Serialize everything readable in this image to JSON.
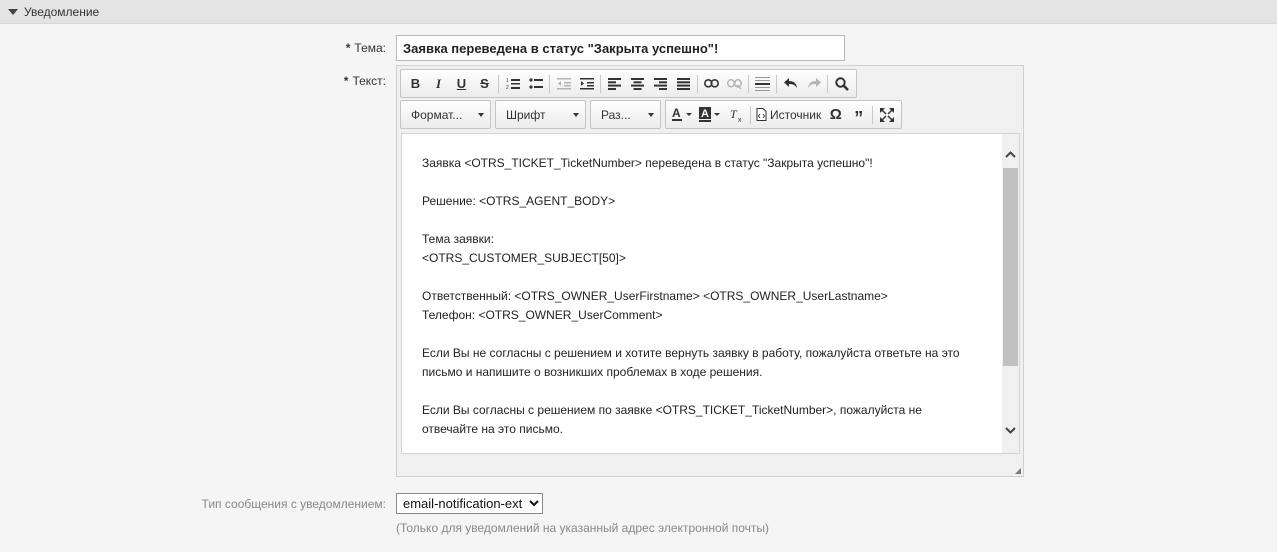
{
  "section": {
    "title": "Уведомление"
  },
  "subject": {
    "label": "Тема:",
    "required_mark": "*",
    "value": "Заявка переведена в статус \"Закрыта успешно\"!"
  },
  "text": {
    "label": "Текст:",
    "required_mark": "*"
  },
  "toolbar": {
    "format_label": "Формат...",
    "font_label": "Шрифт",
    "size_label": "Раз...",
    "source_label": "Источник"
  },
  "body_lines": [
    "Заявка <OTRS_TICKET_TicketNumber> переведена в статус \"Закрыта успешно\"!",
    "",
    "Решение: <OTRS_AGENT_BODY>",
    "",
    "Тема заявки:",
    "<OTRS_CUSTOMER_SUBJECT[50]>",
    "",
    "Ответственный: <OTRS_OWNER_UserFirstname> <OTRS_OWNER_UserLastname>",
    "Телефон: <OTRS_OWNER_UserComment>",
    "",
    "Если Вы не согласны с решением и хотите вернуть заявку в работу, пожалуйста ответьте на это",
    "письмо и напишите о возникших проблемах в ходе решения.",
    "",
    "Если Вы согласны с решением по заявке <OTRS_TICKET_TicketNumber>, пожалуйста не",
    "отвечайте на это письмо."
  ],
  "message_type": {
    "label": "Тип сообщения с уведомлением:",
    "selected": "email-notification-ext",
    "hint": "(Только для уведомлений на указанный адрес электронной почты)"
  },
  "colors": {
    "header_bg": "#e4e4e4",
    "page_bg": "#f5f5f5",
    "muted_text": "#888888"
  }
}
